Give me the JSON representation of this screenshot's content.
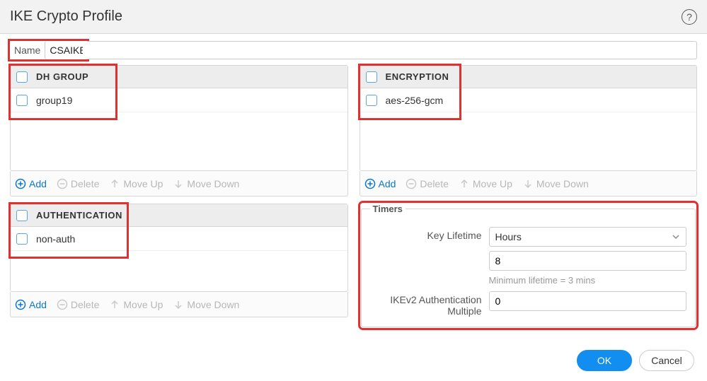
{
  "title": "IKE Crypto Profile",
  "name_label": "Name",
  "name_value": "CSAIKE",
  "sections": {
    "dh": {
      "header": "DH Group",
      "items": [
        "group19"
      ]
    },
    "enc": {
      "header": "Encryption",
      "items": [
        "aes-256-gcm"
      ]
    },
    "auth": {
      "header": "Authentication",
      "items": [
        "non-auth"
      ]
    }
  },
  "toolbar": {
    "add": "Add",
    "delete": "Delete",
    "move_up": "Move Up",
    "move_down": "Move Down"
  },
  "timers": {
    "legend": "Timers",
    "key_lifetime_label": "Key Lifetime",
    "key_lifetime_unit": "Hours",
    "key_lifetime_value": "8",
    "min_hint": "Minimum lifetime = 3 mins",
    "ikev2_label": "IKEv2 Authentication Multiple",
    "ikev2_value": "0"
  },
  "buttons": {
    "ok": "OK",
    "cancel": "Cancel"
  }
}
